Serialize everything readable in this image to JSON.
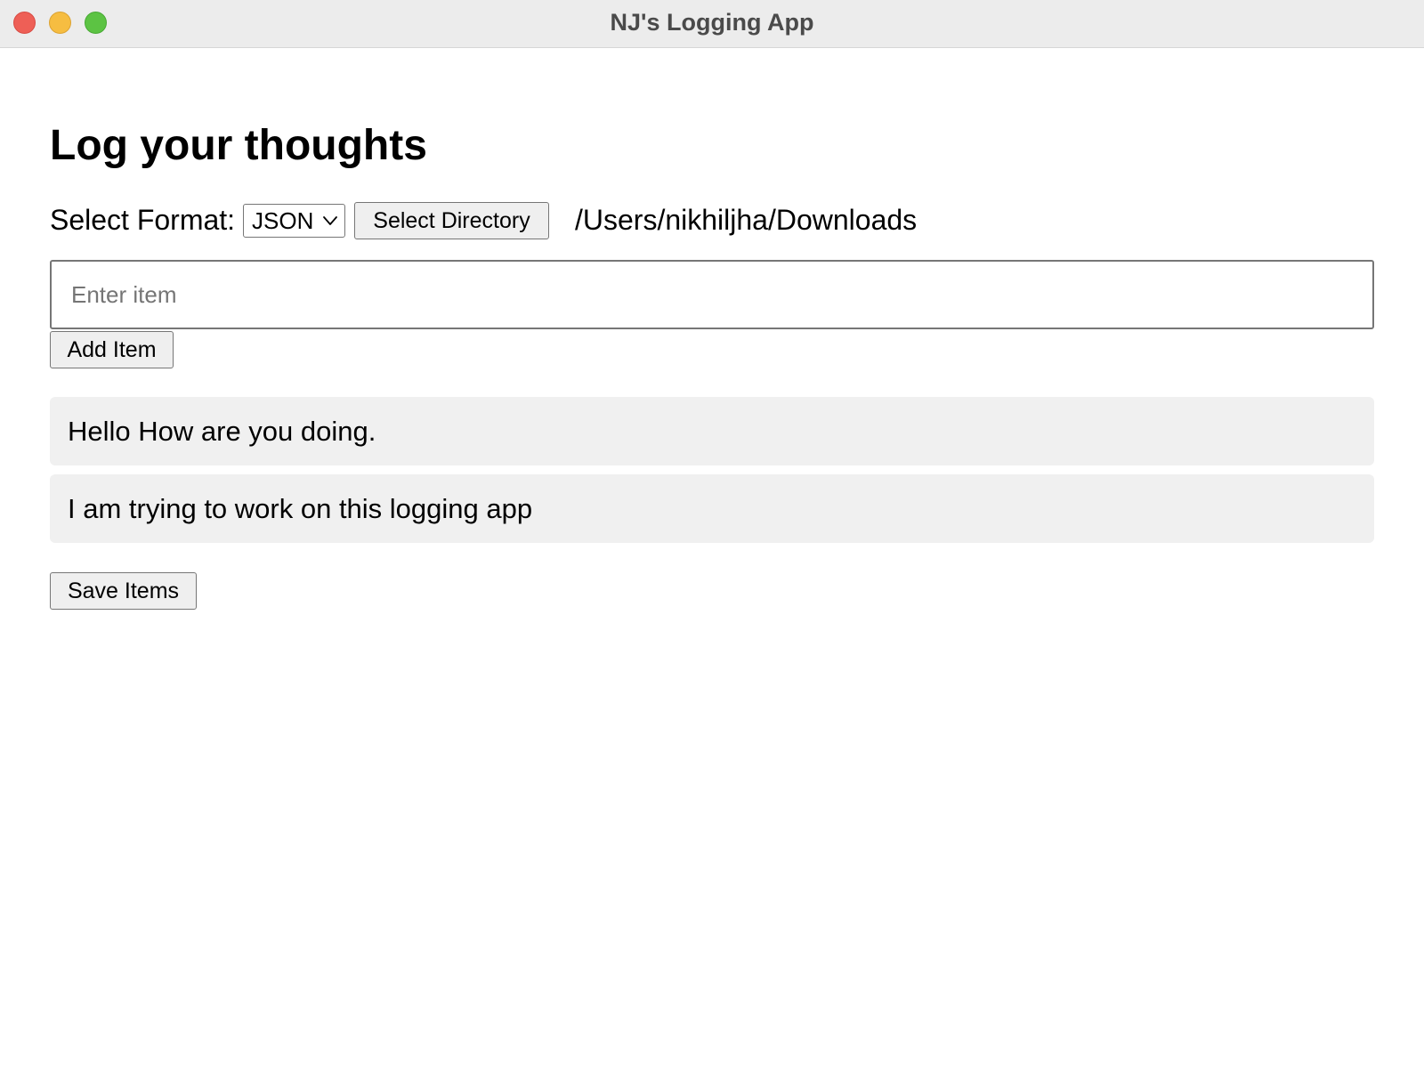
{
  "window": {
    "title": "NJ's Logging App",
    "controls": [
      "close",
      "minimize",
      "maximize"
    ]
  },
  "page": {
    "heading": "Log your thoughts"
  },
  "format": {
    "label": "Select Format:",
    "selected": "JSON"
  },
  "directory": {
    "button_label": "Select Directory",
    "path": "/Users/nikhiljha/Downloads"
  },
  "input": {
    "placeholder": "Enter item",
    "value": ""
  },
  "add_button_label": "Add Item",
  "items": [
    "Hello How are you doing.",
    "I am trying to work on this logging app"
  ],
  "save_button_label": "Save Items",
  "colors": {
    "close": "#ee5f56",
    "minimize": "#f6bd41",
    "maximize": "#5cc343",
    "titlebar": "#ececec",
    "item_background": "#f0f0f0",
    "button_background": "#efefef"
  }
}
